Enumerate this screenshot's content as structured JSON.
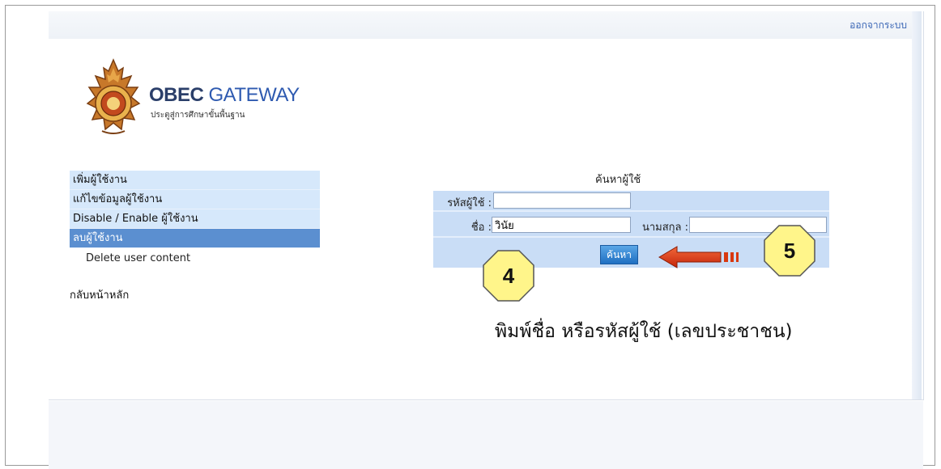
{
  "header": {
    "logout_label": "ออกจากระบบ"
  },
  "logo": {
    "title_a": "OBEC",
    "title_b": "GATEWAY",
    "subtitle": "ประตูสู่การศึกษาขั้นพื้นฐาน"
  },
  "sidebar": {
    "items": [
      {
        "label": "เพิ่มผู้ใช้งาน"
      },
      {
        "label": "แก้ไขข้อมูลผู้ใช้งาน"
      },
      {
        "label": "Disable / Enable ผู้ใช้งาน"
      },
      {
        "label": "ลบผู้ใช้งาน"
      }
    ],
    "sub_item": "Delete user content",
    "home_label": "กลับหน้าหลัก"
  },
  "search": {
    "title": "ค้นหาผู้ใช้",
    "user_id_label": "รหัสผู้ใช้ :",
    "user_id_value": "",
    "first_name_label": "ชื่อ :",
    "first_name_value": "วินัย",
    "last_name_label": "นามสกุล :",
    "last_name_value": "",
    "button_label": "ค้นหา"
  },
  "annotations": {
    "step4": "4",
    "step5": "5",
    "hint": "พิมพ์ชื่อ หรือรหัสผู้ใช้ (เลขประชาชน)",
    "badge_color": "#fff58a",
    "arrow_color": "#e23a10"
  }
}
